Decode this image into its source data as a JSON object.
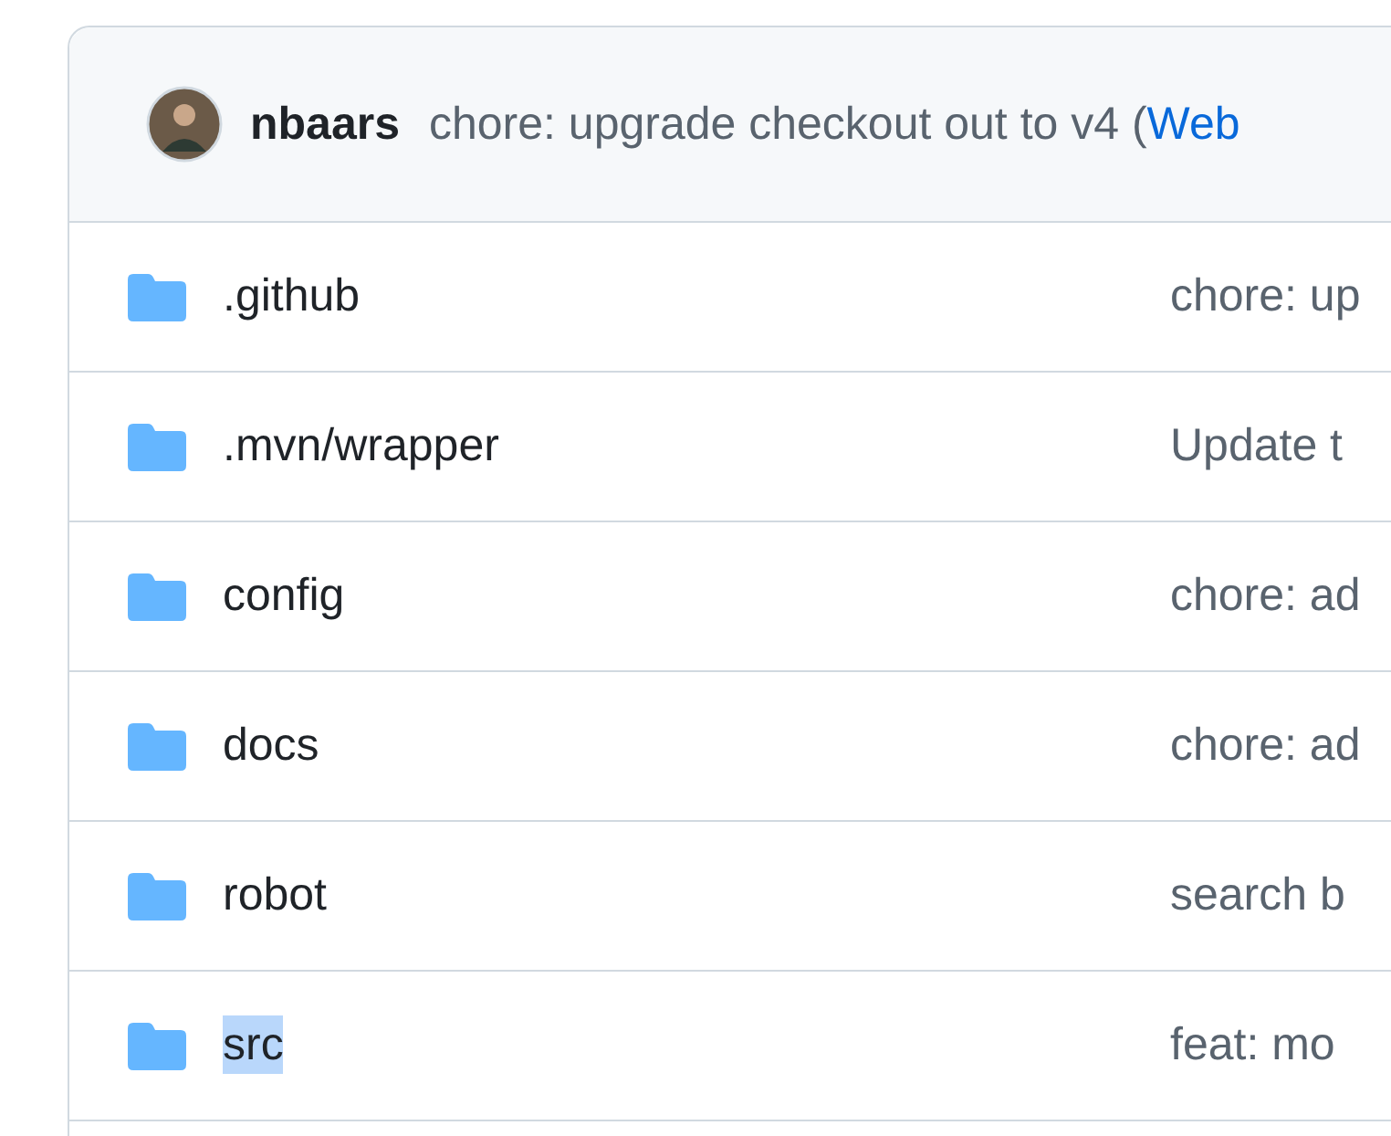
{
  "latest_commit": {
    "author": "nbaars",
    "message": "chore: upgrade checkout out to v4 (",
    "link": "Web"
  },
  "files": [
    {
      "name": ".github",
      "kind": "folder",
      "message": "chore: up",
      "highlighted": false
    },
    {
      "name": ".mvn/wrapper",
      "kind": "folder",
      "message": "Update t",
      "highlighted": false
    },
    {
      "name": "config",
      "kind": "folder",
      "message": "chore: ad",
      "highlighted": false
    },
    {
      "name": "docs",
      "kind": "folder",
      "message": "chore: ad",
      "highlighted": false
    },
    {
      "name": "robot",
      "kind": "folder",
      "message": "search b",
      "highlighted": false
    },
    {
      "name": "src",
      "kind": "folder",
      "message": "feat: mo",
      "highlighted": true
    }
  ]
}
